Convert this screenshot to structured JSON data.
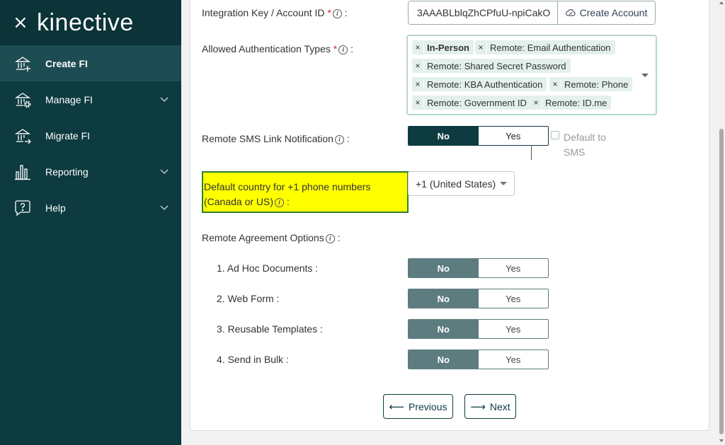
{
  "sidebar": {
    "close_icon": "×",
    "logo": "kinective",
    "items": [
      {
        "label": "Create FI",
        "icon": "bank-add-icon",
        "active": true
      },
      {
        "label": "Manage FI",
        "icon": "bank-gear-icon",
        "expandable": true
      },
      {
        "label": "Migrate FI",
        "icon": "bank-arrow-icon"
      },
      {
        "label": "Reporting",
        "icon": "bar-chart-icon",
        "expandable": true
      },
      {
        "label": "Help",
        "icon": "help-bubble-icon",
        "expandable": true
      }
    ]
  },
  "form": {
    "integration_key": {
      "label": "Integration Key / Account ID",
      "required_mark": "*",
      "info": "i",
      "suffix": ":",
      "value": "3AAABLblqZhCPfuU-npiCakO",
      "create_button": "Create Account"
    },
    "auth_types": {
      "label": "Allowed Authentication Types",
      "required_mark": "*",
      "info": "i",
      "suffix": ":",
      "tags": [
        "In-Person",
        "Remote: Email Authentication",
        "Remote: Shared Secret Password",
        "Remote: KBA Authentication",
        "Remote: Phone",
        "Remote: Government ID",
        "Remote: ID.me"
      ]
    },
    "sms_link": {
      "label": "Remote SMS Link Notification",
      "info": "i",
      "suffix": ":",
      "no": "No",
      "yes": "Yes",
      "default_label": "Default to SMS"
    },
    "country": {
      "label": "Default country for +1 phone numbers (Canada or US)",
      "info": "i",
      "suffix": ":",
      "value": "+1 (United States)"
    },
    "agreement": {
      "label": "Remote Agreement Options",
      "info": "i",
      "suffix": ":",
      "options": [
        {
          "label": "1. Ad Hoc Documents :",
          "no": "No",
          "yes": "Yes"
        },
        {
          "label": "2. Web Form :",
          "no": "No",
          "yes": "Yes"
        },
        {
          "label": "3. Reusable Templates :",
          "no": "No",
          "yes": "Yes"
        },
        {
          "label": "4. Send in Bulk :",
          "no": "No",
          "yes": "Yes"
        }
      ]
    },
    "nav": {
      "previous": "Previous",
      "next": "Next"
    }
  },
  "colors": {
    "sidebar": "#0d3b40",
    "accent": "#0d3b40",
    "tag_bg": "#e3f1ea",
    "highlight": "#ffff00"
  }
}
